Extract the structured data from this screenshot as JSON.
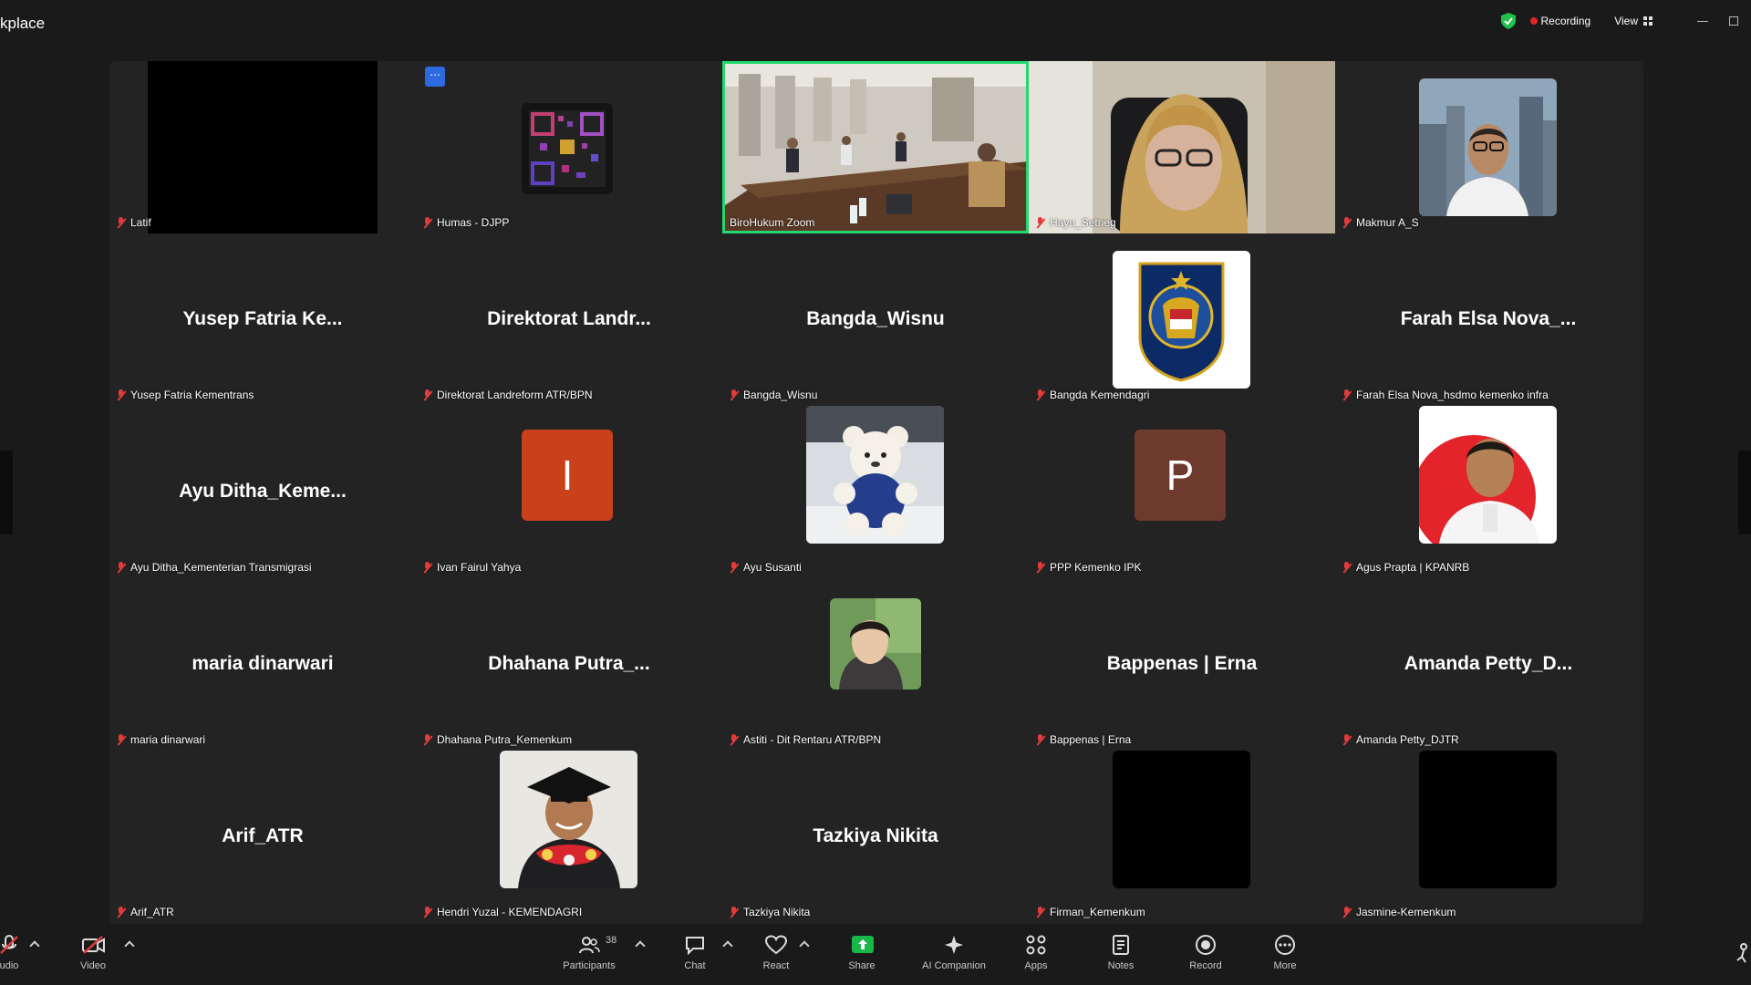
{
  "app": {
    "title": "kplace"
  },
  "status": {
    "recording_label": "Recording",
    "view_label": "View"
  },
  "colors": {
    "accent_green": "#23d96f",
    "muted_red": "#e23b3b",
    "share_green": "#19b648"
  },
  "tiles": [
    {
      "name": "Latif"
    },
    {
      "name": "Humas - DJPP"
    },
    {
      "name": "BiroHukum Zoom"
    },
    {
      "name": "Hayu_Setneg"
    },
    {
      "name": "Makmur A_S"
    },
    {
      "name": "Yusep Fatria Kementrans",
      "display": "Yusep Fatria Ke..."
    },
    {
      "name": "Direktorat Landreform ATR/BPN",
      "display": "Direktorat Landr..."
    },
    {
      "name": "Bangda_Wisnu",
      "display": "Bangda_Wisnu"
    },
    {
      "name": "Bangda Kemendagri"
    },
    {
      "name": "Farah Elsa Nova_hsdmo kemenko infra",
      "display": "Farah Elsa Nova_..."
    },
    {
      "name": "Ayu Ditha_Kementerian Transmigrasi",
      "display": "Ayu Ditha_Keme..."
    },
    {
      "name": "Ivan Fairul Yahya",
      "initial": "I"
    },
    {
      "name": "Ayu Susanti"
    },
    {
      "name": "PPP Kemenko IPK",
      "initial": "P"
    },
    {
      "name": "Agus Prapta | KPANRB"
    },
    {
      "name": "maria dinarwari",
      "display": "maria dinarwari"
    },
    {
      "name": "Dhahana Putra_Kemenkum",
      "display": "Dhahana Putra_..."
    },
    {
      "name": "Astiti - Dit Rentaru ATR/BPN"
    },
    {
      "name": "Bappenas | Erna",
      "display": "Bappenas | Erna"
    },
    {
      "name": "Amanda Petty_DJTR",
      "display": "Amanda Petty_D..."
    },
    {
      "name": "Arif_ATR",
      "display": "Arif_ATR"
    },
    {
      "name": "Hendri Yuzal - KEMENDAGRI"
    },
    {
      "name": "Tazkiya Nikita",
      "display": "Tazkiya Nikita"
    },
    {
      "name": "Firman_Kemenkum"
    },
    {
      "name": "Jasmine-Kemenkum"
    }
  ],
  "toolbar": {
    "audio": "udio",
    "video": "Video",
    "participants": "Participants",
    "participant_count": "38",
    "chat": "Chat",
    "react": "React",
    "share": "Share",
    "ai": "AI Companion",
    "apps": "Apps",
    "notes": "Notes",
    "record": "Record",
    "more": "More"
  }
}
